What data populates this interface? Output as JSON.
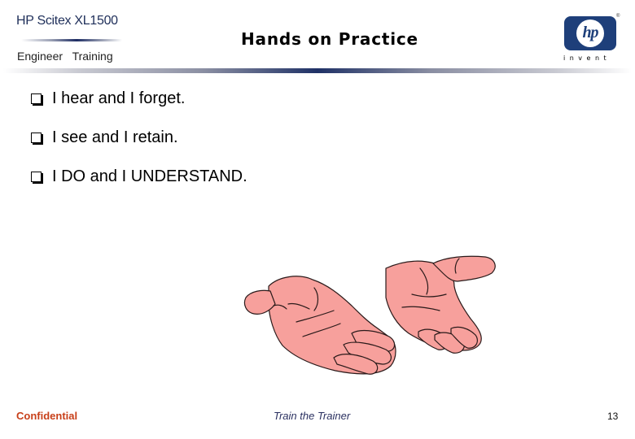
{
  "header": {
    "product_name": "HP Scitex XL1500",
    "subtitle": "Engineer  Training",
    "title": "Hands on Practice",
    "logo": {
      "text": "hp",
      "tagline": "invent",
      "registered_mark": "®",
      "brand_color": "#1e3f7a"
    }
  },
  "bullets": [
    {
      "icon": "checkbox-bullet-icon",
      "text": "I hear and I forget."
    },
    {
      "icon": "checkbox-bullet-icon",
      "text": "I see and I retain."
    },
    {
      "icon": "checkbox-bullet-icon",
      "text": "I DO and I UNDERSTAND."
    }
  ],
  "illustration": {
    "description": "two open hands",
    "fill_color": "#f7a09c"
  },
  "footer": {
    "left": "Confidential",
    "center": "Train the Trainer",
    "page_number": "13",
    "left_color": "#c8401a",
    "center_color": "#2a3060"
  }
}
